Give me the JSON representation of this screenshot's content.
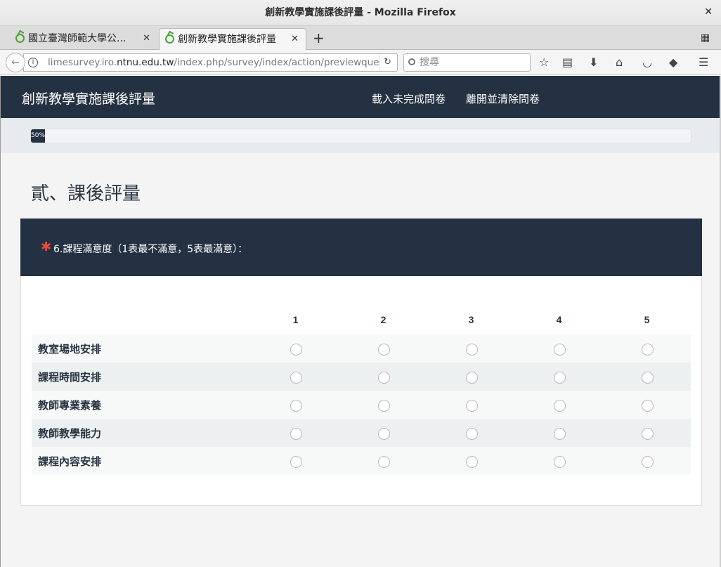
{
  "window": {
    "title": "創新教學實施課後評量 - Mozilla Firefox",
    "close_glyph": "✕"
  },
  "tabs": [
    {
      "label": "國立臺灣師範大學公...",
      "close_glyph": "✕",
      "active": false
    },
    {
      "label": "創新教學實施課後評量",
      "close_glyph": "✕",
      "active": true
    }
  ],
  "toolbar": {
    "url_prefix": "limesurvey.iro.",
    "url_domain": "ntnu.edu.tw",
    "url_suffix": "/index.php/survey/index/action/previewque",
    "search_placeholder": "搜尋",
    "icons": [
      "back-icon",
      "info-icon",
      "reload-icon",
      "search-icon",
      "bookmark-star-icon",
      "reader-list-icon",
      "download-icon",
      "home-icon",
      "pocket-icon",
      "sync-icon",
      "menu-icon"
    ]
  },
  "header": {
    "site_title": "創新教學實施課後評量",
    "nav": {
      "resume": "載入未完成問卷",
      "exit": "離開並清除問卷"
    }
  },
  "progress": {
    "label": "50%",
    "percent": 2
  },
  "group": {
    "title": "貳、課後評量"
  },
  "question": {
    "mandatory_mark": "✱",
    "text": "6.課程滿意度（1表最不滿意，5表最滿意）："
  },
  "matrix": {
    "columns": [
      "1",
      "2",
      "3",
      "4",
      "5"
    ],
    "rows": [
      "教室場地安排",
      "課程時間安排",
      "教師專業素養",
      "教師教學能力",
      "課程內容安排"
    ]
  },
  "colors": {
    "header_bg": "#243142",
    "asterisk": "#e8473c",
    "row_alt": "#ecf0f1"
  }
}
